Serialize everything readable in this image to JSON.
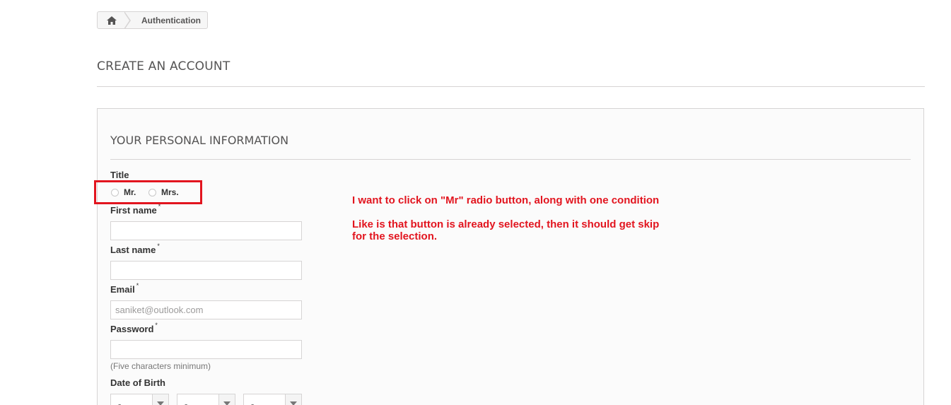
{
  "breadcrumb": {
    "home_icon": "home-icon",
    "current": "Authentication"
  },
  "page": {
    "title": "CREATE AN ACCOUNT"
  },
  "form": {
    "section_title": "YOUR PERSONAL INFORMATION",
    "title_label": "Title",
    "title_options": [
      {
        "label": "Mr.",
        "selected": false
      },
      {
        "label": "Mrs.",
        "selected": false
      }
    ],
    "first_name": {
      "label": "First name",
      "required": "*",
      "value": ""
    },
    "last_name": {
      "label": "Last name",
      "required": "*",
      "value": ""
    },
    "email": {
      "label": "Email",
      "required": "*",
      "value": "saniket@outlook.com"
    },
    "password": {
      "label": "Password",
      "required": "*",
      "value": "",
      "hint": "(Five characters minimum)"
    },
    "dob": {
      "label": "Date of Birth",
      "day": "-",
      "month": "-",
      "year": "-"
    }
  },
  "annotation": {
    "line1": "I want to click on \"Mr\" radio button, along with one condition",
    "line2": "Like is that button is already selected, then it should get skip",
    "line3": "for the selection.",
    "color": "#e2151f"
  }
}
